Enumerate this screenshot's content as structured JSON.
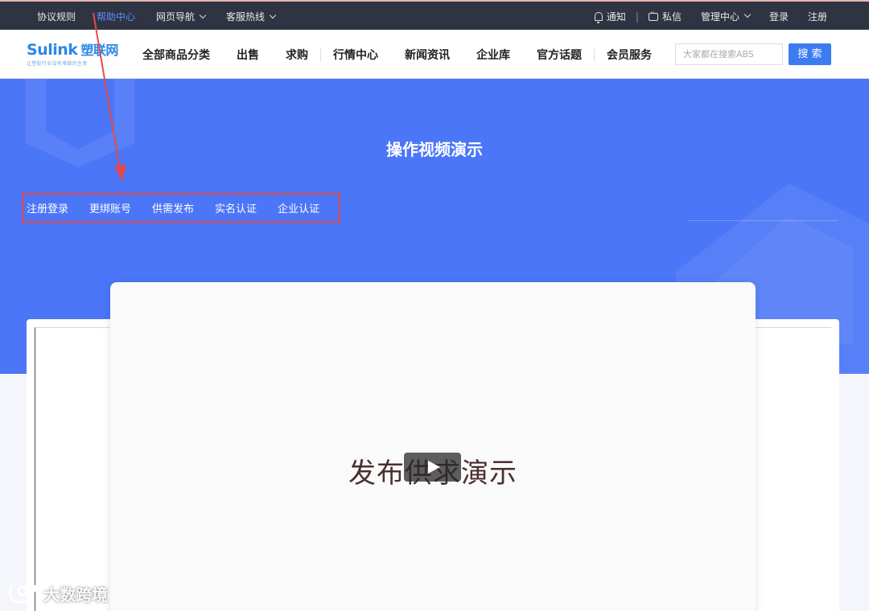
{
  "topbar": {
    "links": [
      "协议规则",
      "帮助中心",
      "网页导航",
      "客服热线"
    ],
    "notice": "通知",
    "separator": "|",
    "message": "私信",
    "manage": "管理中心",
    "login": "登录",
    "register": "注册"
  },
  "logo": {
    "brand_en": "Sulink",
    "brand_cn": "塑联网",
    "tagline": "让塑胶行业没有难做的生意"
  },
  "nav": {
    "items": [
      "全部商品分类",
      "出售",
      "求购",
      "行情中心",
      "新闻资讯",
      "企业库",
      "官方话题",
      "会员服务"
    ]
  },
  "search": {
    "placeholder": "大家都在搜索ABS",
    "button": "搜 索"
  },
  "hero": {
    "title": "操作视频演示",
    "tabs": [
      "注册登录",
      "更绑账号",
      "供需发布",
      "实名认证",
      "企业认证"
    ]
  },
  "video": {
    "title": "发布供求演示"
  },
  "watermark": {
    "text": "大数跨境"
  },
  "colors": {
    "topbar_bg": "#2f3443",
    "active_link": "#5b8cff",
    "hero_bg": "#4b76f7",
    "search_button": "#3d7cf0",
    "annotation_red": "#e54a4a"
  }
}
